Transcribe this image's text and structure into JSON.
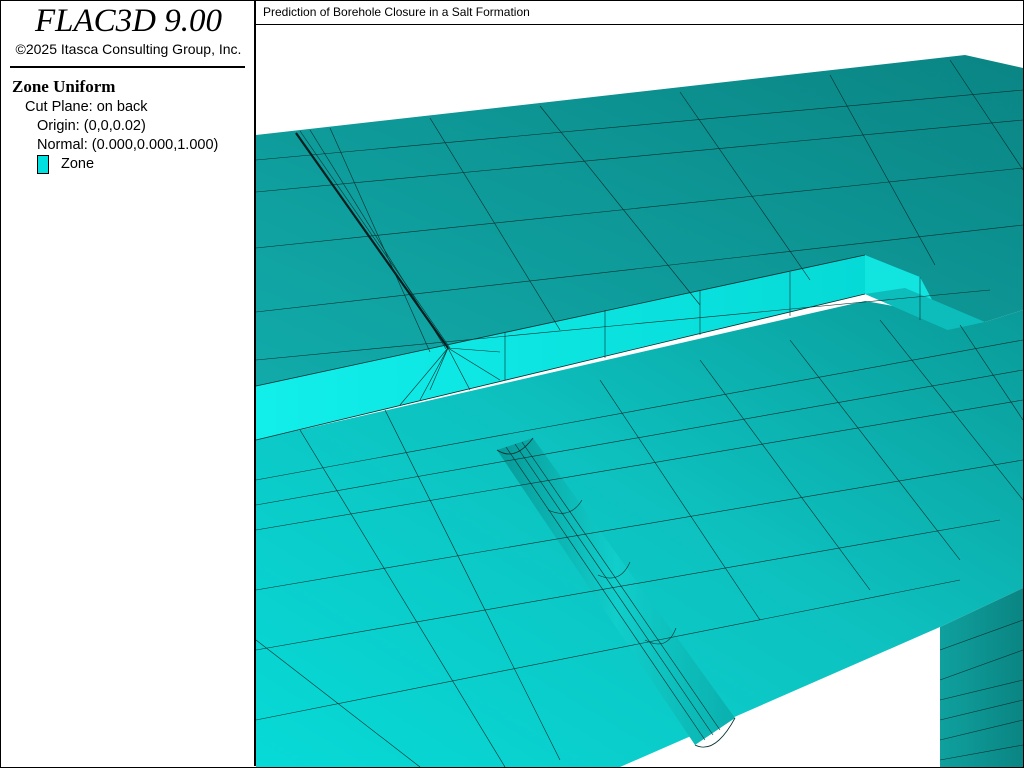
{
  "app": {
    "title": "FLAC3D 9.00",
    "copyright": "©2025 Itasca Consulting Group, Inc."
  },
  "legend": {
    "plot_type": "Zone Uniform",
    "cut_plane": "Cut Plane: on back",
    "origin": "Origin: (0,0,0.02)",
    "normal": "Normal: (0.000,0.000,1.000)",
    "zone_label": "Zone",
    "zone_color": "#00E0E0"
  },
  "view": {
    "title": "Prediction of Borehole Closure in a Salt Formation"
  },
  "colors": {
    "zone_light": "#08DEDA",
    "zone_mid": "#11B5B4",
    "zone_dark": "#0A8E8C",
    "mesh_line": "#04302F"
  }
}
